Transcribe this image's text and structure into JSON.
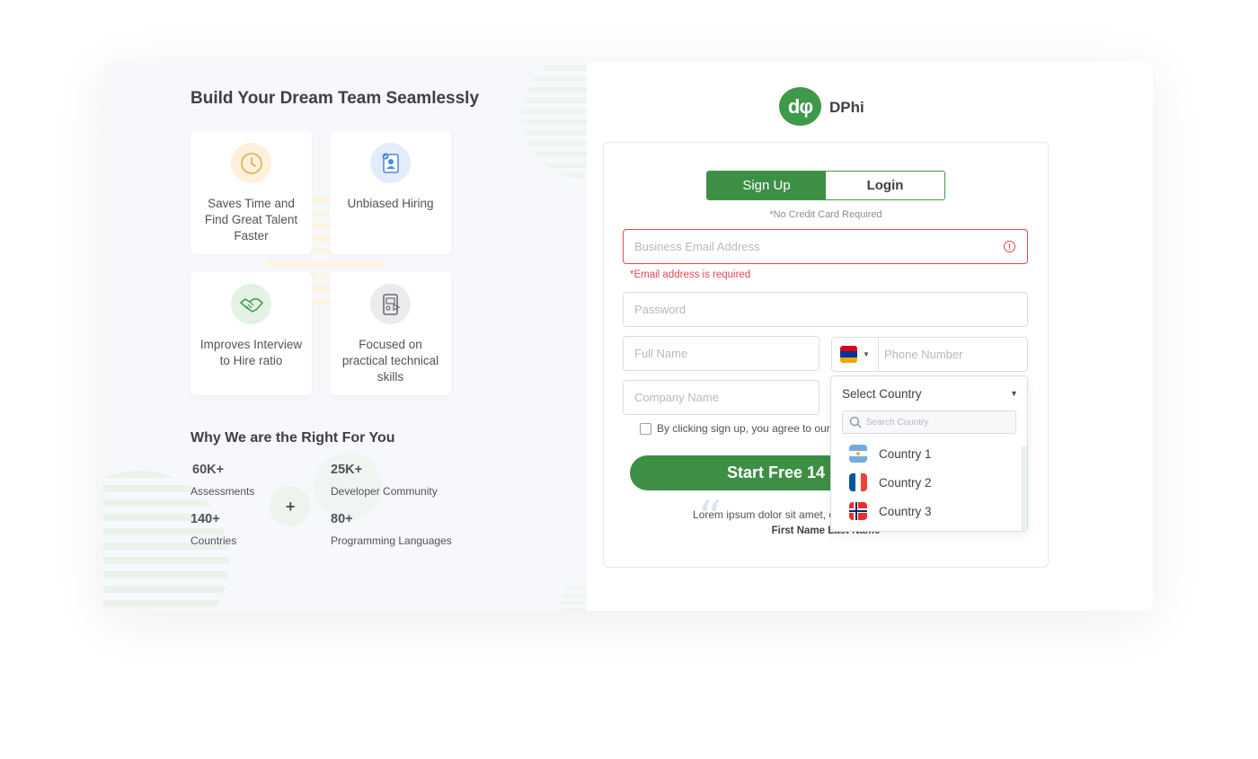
{
  "left": {
    "title": "Build Your Dream Team Seamlessly",
    "features": [
      {
        "label": "Saves Time and Find Great Talent Faster",
        "icon": "clock-icon",
        "bg": "#fdf0dc",
        "color": "#e2b45a"
      },
      {
        "label": "Unbiased Hiring",
        "icon": "document-badge-icon",
        "bg": "#e3ecfb",
        "color": "#4a86e8"
      },
      {
        "label": "Improves Interview to Hire ratio",
        "icon": "handshake-icon",
        "bg": "#e2f2e4",
        "color": "#3d9a48"
      },
      {
        "label": "Focused on practical technical skills",
        "icon": "video-device-icon",
        "bg": "#ebebed",
        "color": "#6b6b72"
      }
    ],
    "why_title": "Why We are the Right For You",
    "stats": [
      {
        "value": "60K+",
        "label": "Assessments"
      },
      {
        "value": "25K+",
        "label": "Developer Community"
      },
      {
        "value": "140+",
        "label": "Countries"
      },
      {
        "value": "80+",
        "label": "Programming Languages"
      }
    ],
    "plus": "+"
  },
  "brand": {
    "logo_mark": "dφ",
    "name": "DPhi",
    "color": "#3d9a48"
  },
  "form": {
    "tab_signup": "Sign Up",
    "tab_login": "Login",
    "note": "*No Credit Card  Required",
    "email_placeholder": "Business Email Address",
    "email_error_icon": "!",
    "email_error": "*Email address is required",
    "password_placeholder": "Password",
    "fullname_placeholder": "Full Name",
    "phone_placeholder": "Phone Number",
    "phone_flag": "armenia-flag-icon",
    "company_placeholder": "Company Name",
    "terms": "By clicking sign up, you agree to our",
    "cta": "Start Free 14",
    "quote_text": "Lorem ipsum dolor sit amet, c",
    "quote_name": "First Name Last Name"
  },
  "country_dropdown": {
    "selected": "Select Country",
    "search_placeholder": "Search Country",
    "options": [
      {
        "label": "Country 1",
        "flag": "argentina-flag-icon"
      },
      {
        "label": "Country 2",
        "flag": "france-flag-icon"
      },
      {
        "label": "Country 3",
        "flag": "norway-flag-icon"
      }
    ]
  }
}
